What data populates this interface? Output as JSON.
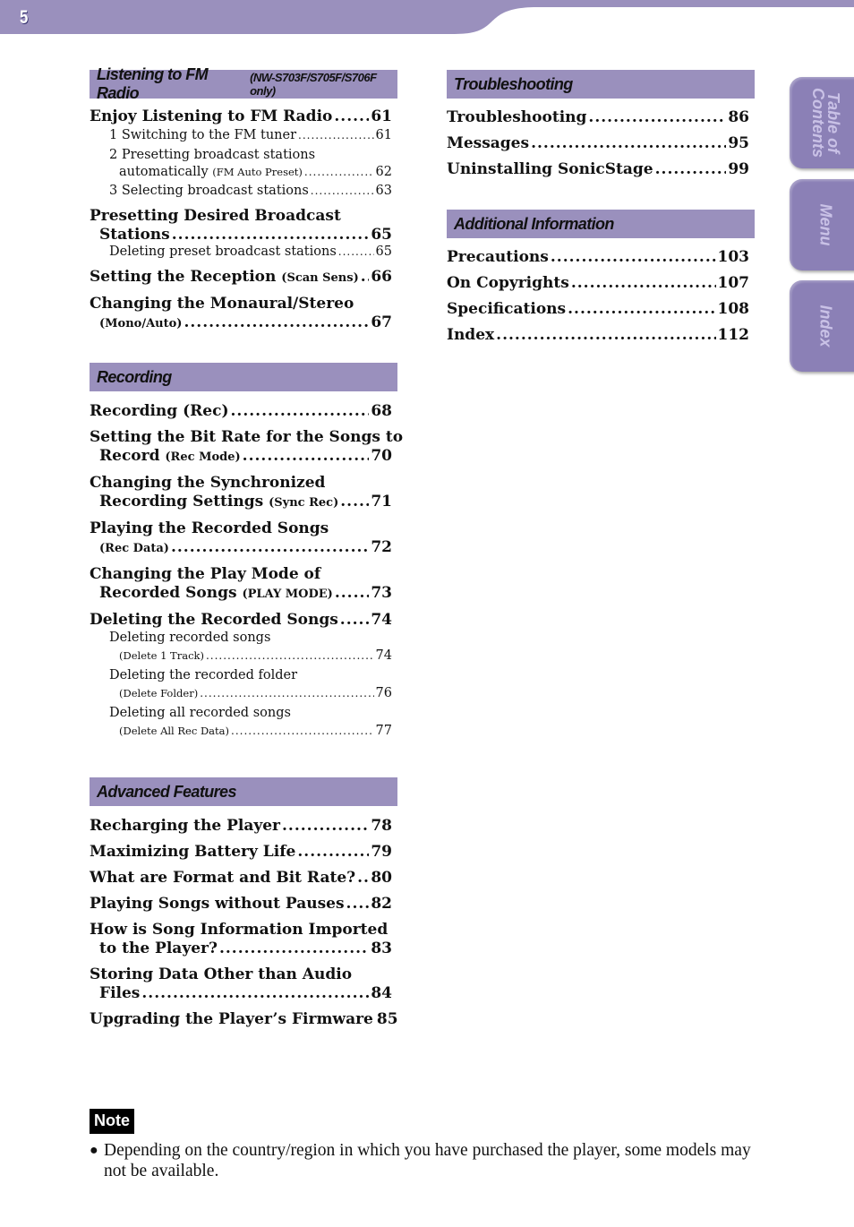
{
  "page": {
    "number": "5"
  },
  "colors": {
    "band": "#9a90bd",
    "tab": "#8b80b6",
    "tab_text": "#c9c1e6"
  },
  "side_tabs": [
    {
      "label": "Table of\nContents",
      "icon": "tab-toc"
    },
    {
      "label": "Menu",
      "icon": "tab-menu"
    },
    {
      "label": "Index",
      "icon": "tab-index"
    }
  ],
  "left": {
    "fm": {
      "title": "Listening to FM Radio",
      "subtitle": "(NW-S703F/S705F/S706F only)",
      "entries": [
        {
          "title": "Enjoy Listening to FM Radio",
          "page": "61"
        },
        {
          "title": "Presetting Desired Broadcast",
          "title2": "Stations",
          "page": "65"
        },
        {
          "title": "Setting the Reception",
          "small": "(Scan Sens)",
          "page": "66"
        },
        {
          "title": "Changing the Monaural/Stereo",
          "small": "(Mono/Auto)",
          "page": "67"
        }
      ],
      "subs": [
        {
          "num": "1",
          "title": "Switching to the FM tuner",
          "page": "61"
        },
        {
          "num": "2",
          "title": "Presetting broadcast stations",
          "title2": "automatically",
          "small": "(FM Auto Preset)",
          "page": "62"
        },
        {
          "num": "3",
          "title": "Selecting broadcast stations",
          "page": "63"
        },
        {
          "title": "Deleting preset broadcast stations",
          "page": "65"
        }
      ]
    },
    "rec": {
      "title": "Recording",
      "entries": [
        {
          "title": "Recording (Rec)",
          "page": "68"
        },
        {
          "title": "Setting the Bit Rate for the Songs to",
          "title2": "Record",
          "small": "(Rec Mode)",
          "page": "70"
        },
        {
          "title": "Changing the Synchronized",
          "title2": "Recording Settings",
          "small": "(Sync Rec)",
          "page": "71"
        },
        {
          "title": "Playing the Recorded Songs",
          "small": "(Rec Data)",
          "page": "72"
        },
        {
          "title": "Changing the Play Mode of",
          "title2": "Recorded Songs",
          "small": "(PLAY MODE)",
          "page": "73"
        },
        {
          "title": "Deleting the Recorded Songs",
          "page": "74"
        }
      ],
      "subs": [
        {
          "title": "Deleting recorded songs",
          "small": "(Delete 1 Track)",
          "page": "74"
        },
        {
          "title": "Deleting the recorded folder",
          "small": "(Delete Folder)",
          "page": "76"
        },
        {
          "title": "Deleting all recorded songs",
          "small": "(Delete All Rec Data)",
          "page": "77"
        }
      ]
    },
    "adv": {
      "title": "Advanced Features",
      "entries": [
        {
          "title": "Recharging the Player",
          "page": "78"
        },
        {
          "title": "Maximizing Battery Life",
          "page": "79"
        },
        {
          "title": "What are Format and Bit Rate?",
          "page": "80"
        },
        {
          "title": "Playing Songs without Pauses",
          "page": "82"
        },
        {
          "title": "How is Song Information Imported",
          "title2": "to the Player?",
          "page": "83"
        },
        {
          "title": "Storing Data Other than Audio",
          "title2": "Files",
          "page": "84"
        },
        {
          "title": "Upgrading the Player’s Firmware",
          "page": "85"
        }
      ]
    }
  },
  "right": {
    "trouble": {
      "title": "Troubleshooting",
      "entries": [
        {
          "title": "Troubleshooting",
          "page": "86"
        },
        {
          "title": "Messages",
          "page": "95"
        },
        {
          "title": "Uninstalling SonicStage",
          "page": "99"
        }
      ]
    },
    "additional": {
      "title": "Additional Information",
      "entries": [
        {
          "title": "Precautions",
          "page": "103"
        },
        {
          "title": "On Copyrights",
          "page": "107"
        },
        {
          "title": "Specifications",
          "page": "108"
        },
        {
          "title": "Index",
          "page": "112"
        }
      ]
    }
  },
  "note": {
    "label": "Note",
    "text": "Depending on the country/region in which you have purchased the player, some models may not be available."
  }
}
